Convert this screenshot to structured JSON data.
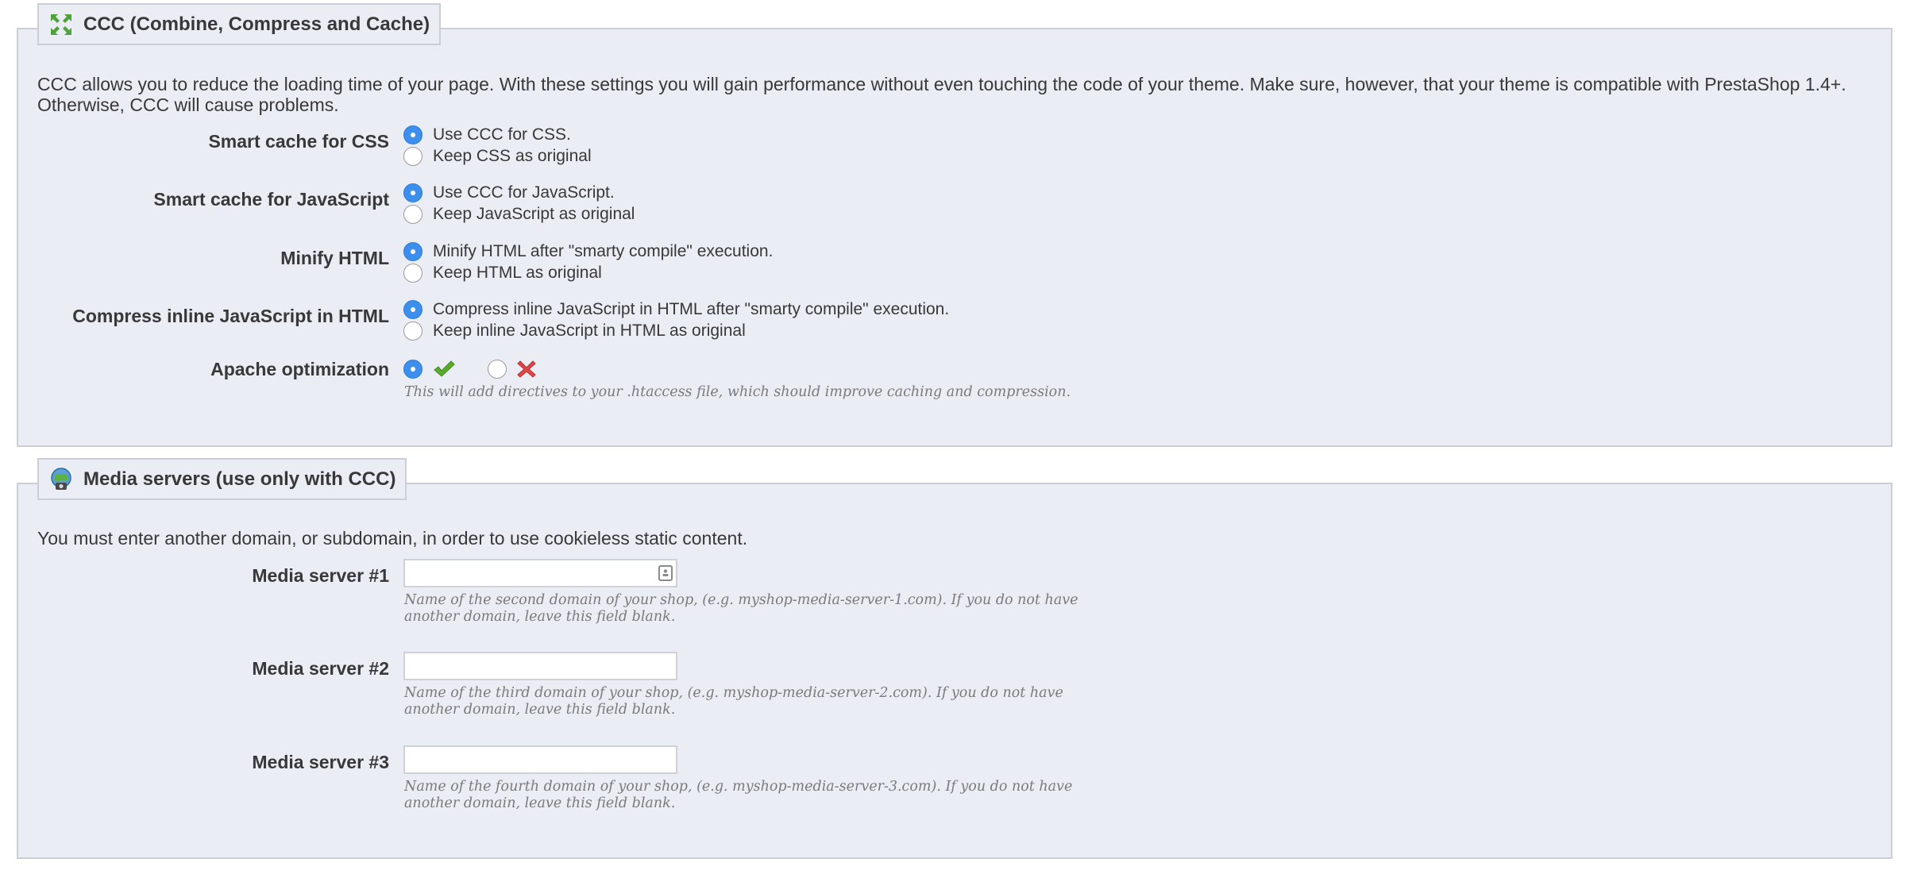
{
  "ccc": {
    "legend": "CCC (Combine, Compress and Cache)",
    "legend_icon": "compress-arrows-icon",
    "intro": "CCC allows you to reduce the loading time of your page. With these settings you will gain performance without even touching the code of your theme. Make sure, however, that your theme is compatible with PrestaShop 1.4+. Otherwise, CCC will cause problems.",
    "settings": [
      {
        "label": "Smart cache for CSS",
        "options": [
          "Use CCC for CSS.",
          "Keep CSS as original"
        ],
        "selected": 0
      },
      {
        "label": "Smart cache for JavaScript",
        "options": [
          "Use CCC for JavaScript.",
          "Keep JavaScript as original"
        ],
        "selected": 0
      },
      {
        "label": "Minify HTML",
        "options": [
          "Minify HTML after \"smarty compile\" execution.",
          "Keep HTML as original"
        ],
        "selected": 0
      },
      {
        "label": "Compress inline JavaScript in HTML",
        "options": [
          "Compress inline JavaScript in HTML after \"smarty compile\" execution.",
          "Keep inline JavaScript in HTML as original"
        ],
        "selected": 0
      }
    ],
    "apache": {
      "label": "Apache optimization",
      "selected": "yes",
      "yes_icon": "check-icon",
      "no_icon": "cross-icon",
      "hint": "This will add directives to your .htaccess file, which should improve caching and compression."
    }
  },
  "media": {
    "legend": "Media servers (use only with CCC)",
    "legend_icon": "media-server-icon",
    "intro": "You must enter another domain, or subdomain, in order to use cookieless static content.",
    "servers": [
      {
        "label": "Media server #1",
        "value": "",
        "hint_line1": "Name of the second domain of your shop, (e.g. myshop-media-server-1.com). If you do not have",
        "hint_line2": "another domain, leave this field blank."
      },
      {
        "label": "Media server #2",
        "value": "",
        "hint_line1": "Name of the third domain of your shop, (e.g. myshop-media-server-2.com). If you do not have",
        "hint_line2": "another domain, leave this field blank."
      },
      {
        "label": "Media server #3",
        "value": "",
        "hint_line1": "Name of the fourth domain of your shop, (e.g. myshop-media-server-3.com). If you do not have",
        "hint_line2": "another domain, leave this field blank."
      }
    ]
  },
  "colors": {
    "panel_bg": "#ebedf4",
    "panel_border": "#ccced7",
    "radio_selected": "#3c8fec",
    "check_green": "#5aab2e",
    "cross_red": "#e04848"
  }
}
